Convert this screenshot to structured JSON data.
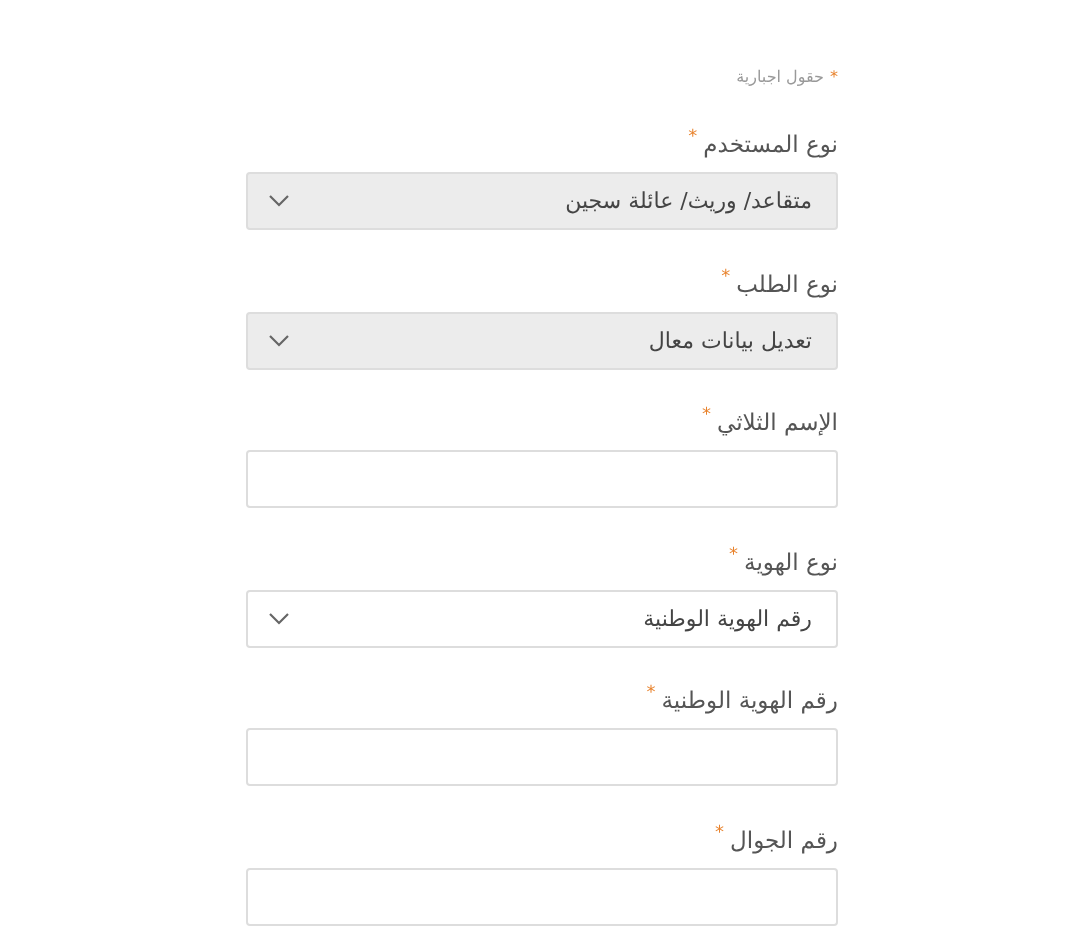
{
  "required_note": {
    "mark": "*",
    "text": "حقول اجبارية"
  },
  "fields": [
    {
      "kind": "select",
      "label": "نوع المستخدم",
      "required_mark": "*",
      "value": "متقاعد/ وريث/ عائلة سجين",
      "disabled": true
    },
    {
      "kind": "select",
      "label": "نوع الطلب",
      "required_mark": "*",
      "value": "تعديل بيانات معال",
      "disabled": true
    },
    {
      "kind": "text",
      "label": "الإسم الثلاثي",
      "required_mark": "*"
    },
    {
      "kind": "select",
      "label": "نوع الهوية",
      "required_mark": "*",
      "value": "رقم الهوية الوطنية",
      "disabled": false
    },
    {
      "kind": "text",
      "label": "رقم الهوية الوطنية",
      "required_mark": "*"
    },
    {
      "kind": "text",
      "label": "رقم الجوال",
      "required_mark": "*"
    }
  ]
}
